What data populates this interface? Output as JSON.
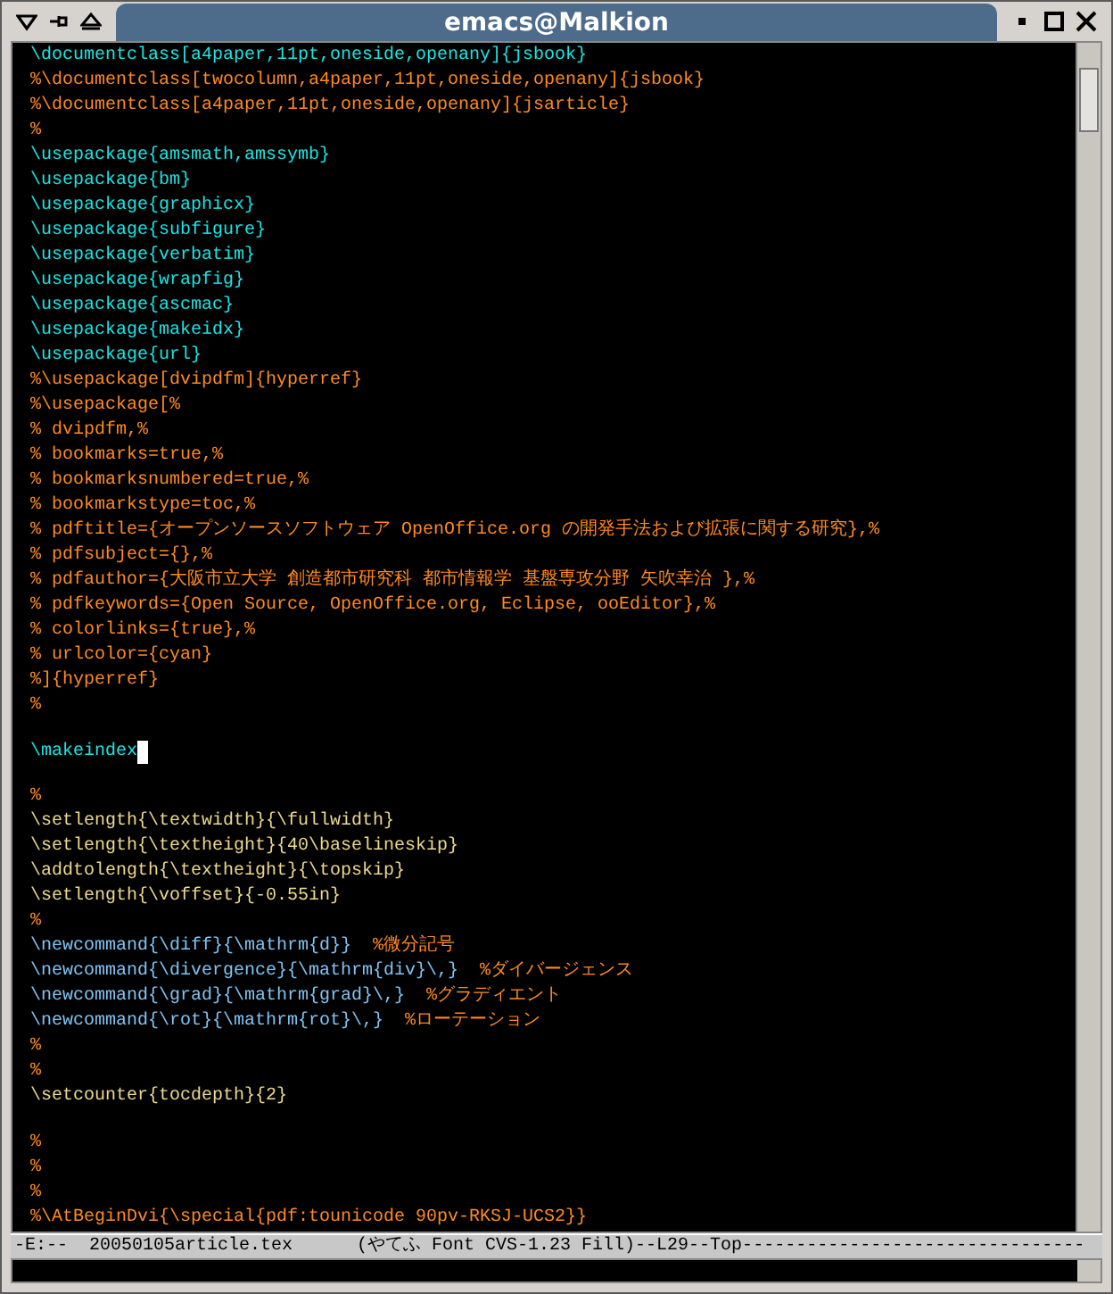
{
  "window": {
    "title": "emacs@Malkion"
  },
  "editor": {
    "lines": [
      {
        "kind": "code",
        "cursor": false,
        "segments": [
          {
            "kind": "keyword",
            "text": "\\documentclass[a4paper,11pt,oneside,openany]{jsbook}"
          }
        ]
      },
      {
        "kind": "code",
        "cursor": false,
        "segments": [
          {
            "kind": "comment",
            "text": "%\\documentclass[twocolumn,a4paper,11pt,oneside,openany]{jsbook}"
          }
        ]
      },
      {
        "kind": "code",
        "cursor": false,
        "segments": [
          {
            "kind": "comment",
            "text": "%\\documentclass[a4paper,11pt,oneside,openany]{jsarticle}"
          }
        ]
      },
      {
        "kind": "code",
        "cursor": false,
        "segments": [
          {
            "kind": "comment",
            "text": "%"
          }
        ]
      },
      {
        "kind": "code",
        "cursor": false,
        "segments": [
          {
            "kind": "keyword",
            "text": "\\usepackage{amsmath,amssymb}"
          }
        ]
      },
      {
        "kind": "code",
        "cursor": false,
        "segments": [
          {
            "kind": "keyword",
            "text": "\\usepackage{bm}"
          }
        ]
      },
      {
        "kind": "code",
        "cursor": false,
        "segments": [
          {
            "kind": "keyword",
            "text": "\\usepackage{graphicx}"
          }
        ]
      },
      {
        "kind": "code",
        "cursor": false,
        "segments": [
          {
            "kind": "keyword",
            "text": "\\usepackage{subfigure}"
          }
        ]
      },
      {
        "kind": "code",
        "cursor": false,
        "segments": [
          {
            "kind": "keyword",
            "text": "\\usepackage{verbatim}"
          }
        ]
      },
      {
        "kind": "code",
        "cursor": false,
        "segments": [
          {
            "kind": "keyword",
            "text": "\\usepackage{wrapfig}"
          }
        ]
      },
      {
        "kind": "code",
        "cursor": false,
        "segments": [
          {
            "kind": "keyword",
            "text": "\\usepackage{ascmac}"
          }
        ]
      },
      {
        "kind": "code",
        "cursor": false,
        "segments": [
          {
            "kind": "keyword",
            "text": "\\usepackage{makeidx}"
          }
        ]
      },
      {
        "kind": "code",
        "cursor": false,
        "segments": [
          {
            "kind": "keyword",
            "text": "\\usepackage{url}"
          }
        ]
      },
      {
        "kind": "code",
        "cursor": false,
        "segments": [
          {
            "kind": "comment",
            "text": "%\\usepackage[dvipdfm]{hyperref}"
          }
        ]
      },
      {
        "kind": "code",
        "cursor": false,
        "segments": [
          {
            "kind": "comment",
            "text": "%\\usepackage[%"
          }
        ]
      },
      {
        "kind": "code",
        "cursor": false,
        "segments": [
          {
            "kind": "comment",
            "text": "% dvipdfm,%"
          }
        ]
      },
      {
        "kind": "code",
        "cursor": false,
        "segments": [
          {
            "kind": "comment",
            "text": "% bookmarks=true,%"
          }
        ]
      },
      {
        "kind": "code",
        "cursor": false,
        "segments": [
          {
            "kind": "comment",
            "text": "% bookmarksnumbered=true,%"
          }
        ]
      },
      {
        "kind": "code",
        "cursor": false,
        "segments": [
          {
            "kind": "comment",
            "text": "% bookmarkstype=toc,%"
          }
        ]
      },
      {
        "kind": "code",
        "cursor": false,
        "segments": [
          {
            "kind": "comment",
            "text": "% pdftitle={オープンソースソフトウェア OpenOffice.org の開発手法および拡張に関する研究},%"
          }
        ]
      },
      {
        "kind": "code",
        "cursor": false,
        "segments": [
          {
            "kind": "comment",
            "text": "% pdfsubject={},%"
          }
        ]
      },
      {
        "kind": "code",
        "cursor": false,
        "segments": [
          {
            "kind": "comment",
            "text": "% pdfauthor={大阪市立大学 創造都市研究科 都市情報学 基盤専攻分野 矢吹幸治 },%"
          }
        ]
      },
      {
        "kind": "code",
        "cursor": false,
        "segments": [
          {
            "kind": "comment",
            "text": "% pdfkeywords={Open Source, OpenOffice.org, Eclipse, ooEditor},%"
          }
        ]
      },
      {
        "kind": "code",
        "cursor": false,
        "segments": [
          {
            "kind": "comment",
            "text": "% colorlinks={true},%"
          }
        ]
      },
      {
        "kind": "code",
        "cursor": false,
        "segments": [
          {
            "kind": "comment",
            "text": "% urlcolor={cyan}"
          }
        ]
      },
      {
        "kind": "code",
        "cursor": false,
        "segments": [
          {
            "kind": "comment",
            "text": "%]{hyperref}"
          }
        ]
      },
      {
        "kind": "code",
        "cursor": false,
        "segments": [
          {
            "kind": "comment",
            "text": "%"
          }
        ]
      },
      {
        "kind": "blank",
        "cursor": false
      },
      {
        "kind": "code",
        "cursor": true,
        "segments": [
          {
            "kind": "keyword",
            "text": "\\makeindex"
          }
        ]
      },
      {
        "kind": "blank",
        "cursor": false
      },
      {
        "kind": "code",
        "cursor": false,
        "segments": [
          {
            "kind": "comment",
            "text": "%"
          }
        ]
      },
      {
        "kind": "code",
        "cursor": false,
        "segments": [
          {
            "kind": "plain",
            "text": "\\setlength{\\textwidth}{\\fullwidth}"
          }
        ]
      },
      {
        "kind": "code",
        "cursor": false,
        "segments": [
          {
            "kind": "plain",
            "text": "\\setlength{\\textheight}{40\\baselineskip}"
          }
        ]
      },
      {
        "kind": "code",
        "cursor": false,
        "segments": [
          {
            "kind": "plain",
            "text": "\\addtolength{\\textheight}{\\topskip}"
          }
        ]
      },
      {
        "kind": "code",
        "cursor": false,
        "segments": [
          {
            "kind": "plain",
            "text": "\\setlength{\\voffset}{-0.55in}"
          }
        ]
      },
      {
        "kind": "code",
        "cursor": false,
        "segments": [
          {
            "kind": "comment",
            "text": "%"
          }
        ]
      },
      {
        "kind": "code",
        "cursor": false,
        "segments": [
          {
            "kind": "function",
            "text": "\\newcommand{\\diff}{\\mathrm{d}}  "
          },
          {
            "kind": "comment",
            "text": "%微分記号"
          }
        ]
      },
      {
        "kind": "code",
        "cursor": false,
        "segments": [
          {
            "kind": "function",
            "text": "\\newcommand{\\divergence}{\\mathrm{div}\\,}  "
          },
          {
            "kind": "comment",
            "text": "%ダイバージェンス"
          }
        ]
      },
      {
        "kind": "code",
        "cursor": false,
        "segments": [
          {
            "kind": "function",
            "text": "\\newcommand{\\grad}{\\mathrm{grad}\\,}  "
          },
          {
            "kind": "comment",
            "text": "%グラディエント"
          }
        ]
      },
      {
        "kind": "code",
        "cursor": false,
        "segments": [
          {
            "kind": "function",
            "text": "\\newcommand{\\rot}{\\mathrm{rot}\\,}  "
          },
          {
            "kind": "comment",
            "text": "%ローテーション"
          }
        ]
      },
      {
        "kind": "code",
        "cursor": false,
        "segments": [
          {
            "kind": "comment",
            "text": "%"
          }
        ]
      },
      {
        "kind": "code",
        "cursor": false,
        "segments": [
          {
            "kind": "comment",
            "text": "%"
          }
        ]
      },
      {
        "kind": "code",
        "cursor": false,
        "segments": [
          {
            "kind": "plain",
            "text": "\\setcounter{tocdepth}{2}"
          }
        ]
      },
      {
        "kind": "blank",
        "cursor": false
      },
      {
        "kind": "code",
        "cursor": false,
        "segments": [
          {
            "kind": "comment",
            "text": "%"
          }
        ]
      },
      {
        "kind": "code",
        "cursor": false,
        "segments": [
          {
            "kind": "comment",
            "text": "%"
          }
        ]
      },
      {
        "kind": "code",
        "cursor": false,
        "segments": [
          {
            "kind": "comment",
            "text": "%"
          }
        ]
      },
      {
        "kind": "code",
        "cursor": false,
        "segments": [
          {
            "kind": "comment",
            "text": "%\\AtBeginDvi{\\special{pdf:tounicode 90pv-RKSJ-UCS2}}"
          }
        ]
      }
    ]
  },
  "mode_line": {
    "text": "-E:--  20050105article.tex      (やてふ Font CVS-1.23 Fill)--L29--Top--------------------------------"
  }
}
